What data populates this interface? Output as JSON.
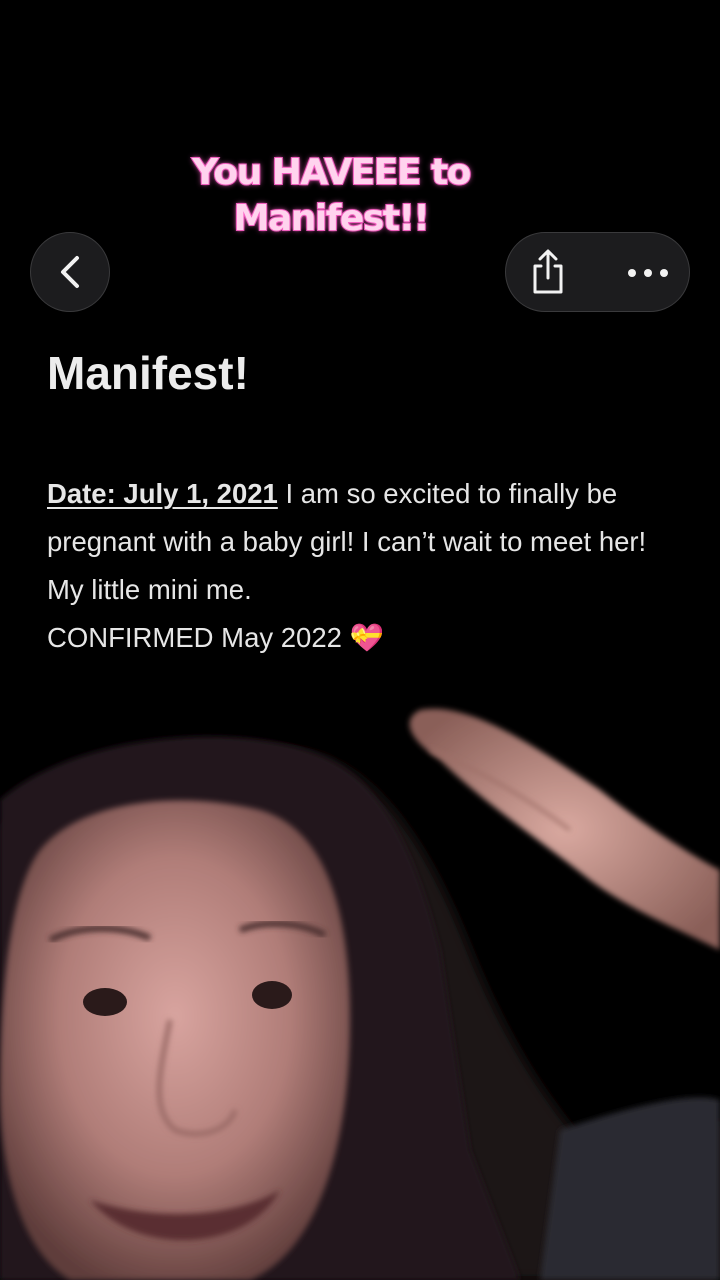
{
  "overlay": {
    "caption_line1": "You HAVEEE to",
    "caption_line2": "Manifest!!"
  },
  "toolbar": {
    "back_icon": "chevron-left-icon",
    "share_icon": "share-icon",
    "more_icon": "ellipsis-icon"
  },
  "note": {
    "title": "Manifest!",
    "date_link": "Date: July 1, 2021",
    "body_text": " I am so excited to finally be pregnant with a baby girl! I can’t wait to meet her! My little mini me.",
    "confirmed_text": "CONFIRMED May 2022 ",
    "heart_emoji": "💝"
  },
  "colors": {
    "background": "#000000",
    "button_bg": "#1c1c1e",
    "caption_fill": "#ffd3ee",
    "caption_stroke": "#e05ab4",
    "text": "#e6e6e6"
  }
}
